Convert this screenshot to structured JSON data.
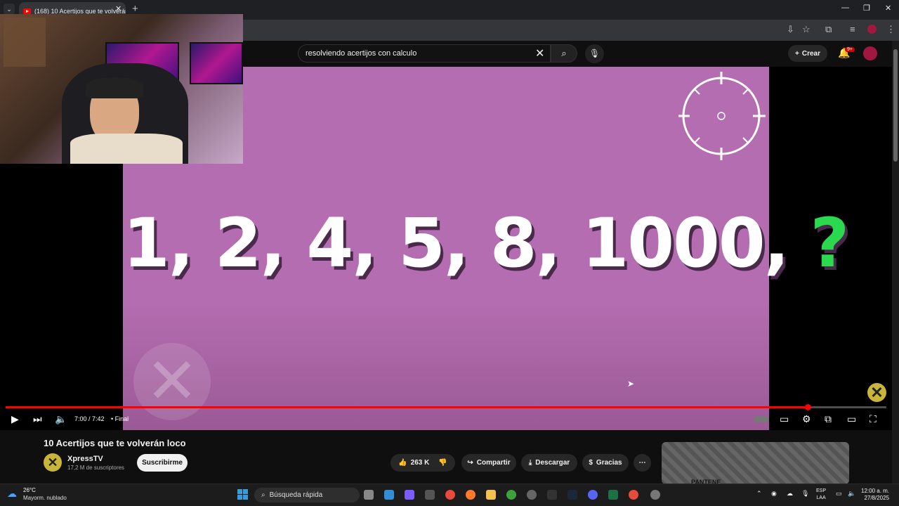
{
  "browser": {
    "tab_title": "(168) 10 Acertijos que te volverán loco",
    "new_tab": "+",
    "close": "✕",
    "win_min": "—",
    "win_max": "❐",
    "win_close": "✕"
  },
  "youtube": {
    "search_value": "resolviendo acertijos con calculo",
    "create_label": "Crear",
    "notif_badge": "9+"
  },
  "video": {
    "sequence_text": "1, 2, 4, 5, 8, 1000, ",
    "question_mark": "?",
    "time": "7:00 / 7:42",
    "chapter": "• Final",
    "progress_fraction": 0.909
  },
  "below": {
    "title": "10 Acertijos que te volverán loco",
    "channel_name": "XpressTV",
    "subscribers": "17,2 M de suscriptores",
    "subscribe_label": "Suscribirme",
    "likes": "263 K",
    "share_label": "Compartir",
    "download_label": "Descargar",
    "thanks_label": "Gracias",
    "ad_text": "PANTENE"
  },
  "taskbar": {
    "temp": "26°C",
    "weather": "Mayorm. nublado",
    "search_label": "Búsqueda rápida",
    "lang_1": "ESP",
    "lang_2": "LAA",
    "time": "12:00 a. m.",
    "date": "27/8/2025"
  },
  "colors": {
    "accent": "#ff0000",
    "video_bg": "#b46db0",
    "question": "#2bd94f"
  }
}
